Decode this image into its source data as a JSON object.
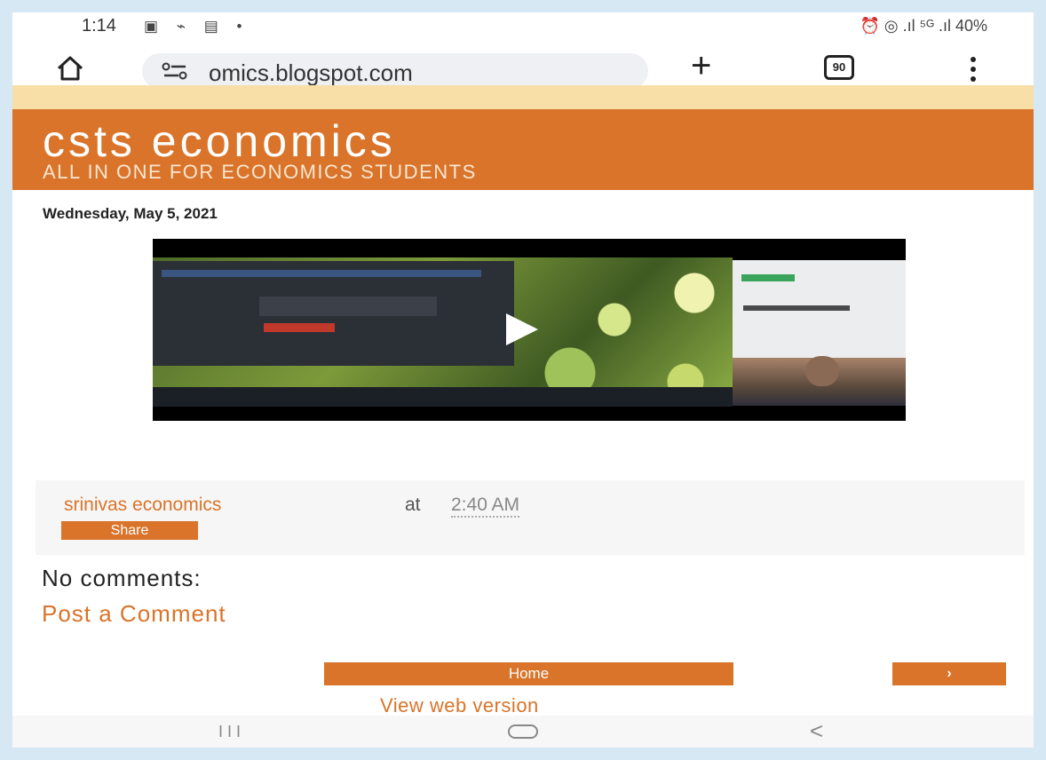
{
  "status_bar": {
    "time": "1:14",
    "left_icons": "▣ ⌁ ▤ •",
    "right_icons": "⏰ ◎ .ıl ⁵ᴳ .ıl 40%",
    "battery": "40%"
  },
  "browser": {
    "url": "omics.blogspot.com",
    "tab_count": "90"
  },
  "blog": {
    "title": "csts economics",
    "description": "ALL IN ONE FOR ECONOMICS STUDENTS",
    "date": "Wednesday, May 5, 2021"
  },
  "post_footer": {
    "author": "srinivas economics",
    "at": "at",
    "time": "2:40 AM",
    "share_label": "Share"
  },
  "comments": {
    "heading": "No comments:",
    "post_link": "Post a Comment"
  },
  "pager": {
    "home_label": "Home",
    "older_label": "›"
  },
  "footer": {
    "web_version": "View web version"
  },
  "nav": {
    "recent": "III",
    "back": "<"
  },
  "colors": {
    "accent": "#d9742a",
    "cream": "#f8dfa7",
    "background": "#ffffff"
  }
}
